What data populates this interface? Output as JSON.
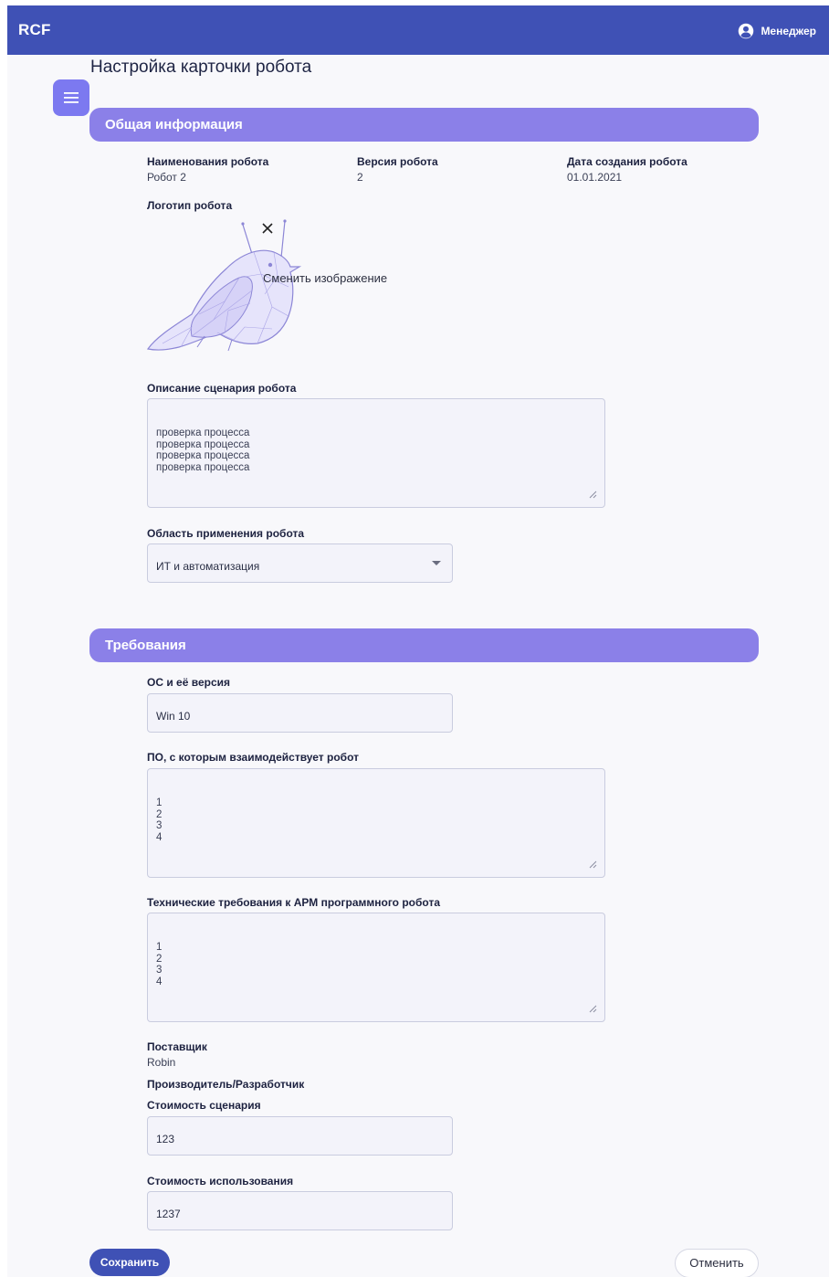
{
  "header": {
    "brand": "RCF",
    "user_name": "Менеджер"
  },
  "page": {
    "title": "Настройка карточки робота"
  },
  "general": {
    "section_title": "Общая информация",
    "name_label": "Наименования робота",
    "name_value": "Робот 2",
    "version_label": "Версия робота",
    "version_value": "2",
    "date_label": "Дата создания робота",
    "date_value": "01.01.2021",
    "logo_label": "Логотип робота",
    "change_image": "Сменить изображение",
    "description_label": "Описание сценария робота",
    "description_value": "проверка процесса\nпроверка процесса\nпроверка процесса\nпроверка процесса",
    "area_label": "Область применения робота",
    "area_value": "ИТ и автоматизация"
  },
  "requirements": {
    "section_title": "Требования",
    "os_label": "ОС и её версия",
    "os_value": "Win 10",
    "software_label": "ПО, с которым взаимодействует робот",
    "software_value": "1\n2\n3\n4",
    "tech_label": "Технические требования к АРМ программного робота",
    "tech_value": "1\n2\n3\n4",
    "supplier_label": "Поставщик",
    "supplier_value": "Robin",
    "manufacturer_label": "Производитель/Разработчик",
    "scenario_cost_label": "Стоимость сценария",
    "scenario_cost_value": "123",
    "usage_cost_label": "Стоимость использования",
    "usage_cost_value": "1237"
  },
  "actions": {
    "save": "Сохранить",
    "cancel": "Отменить"
  },
  "colors": {
    "topbar": "#3f51b5",
    "section_header": "#8b80e8",
    "menu_button": "#7c79f0"
  },
  "icons": {
    "user": "account-circle-icon",
    "menu": "hamburger-menu-icon",
    "close": "close-icon",
    "dropdown": "caret-down-icon",
    "resize": "resize-handle-icon"
  }
}
